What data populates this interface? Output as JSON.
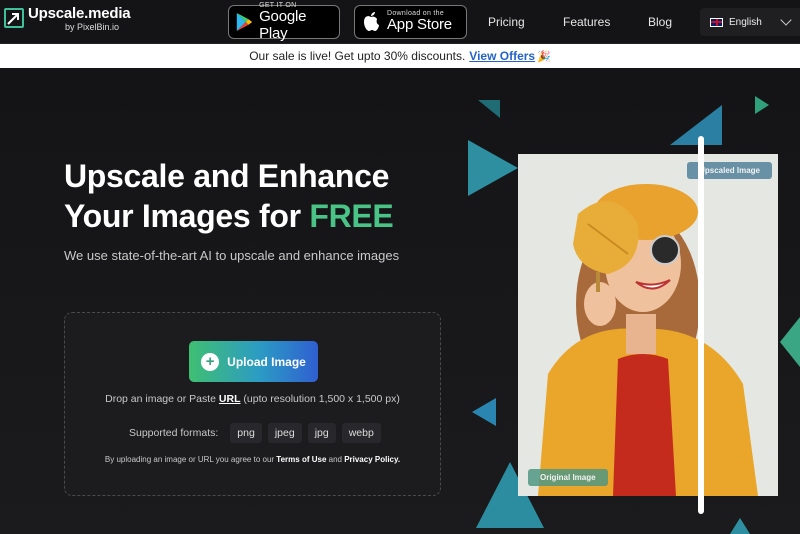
{
  "brand": {
    "name": "Upscale.media",
    "sub": "by PixelBin.io"
  },
  "stores": {
    "google": {
      "small": "GET IT ON",
      "big": "Google Play"
    },
    "apple": {
      "small": "Download on the",
      "big": "App Store"
    }
  },
  "nav": {
    "pricing": "Pricing",
    "features": "Features",
    "blog": "Blog",
    "language": "English"
  },
  "banner": {
    "text": "Our sale is live! Get upto 30% discounts.",
    "link": "View Offers",
    "emoji": "🎉"
  },
  "hero": {
    "line1": "Upscale and Enhance",
    "line2_pre": "Your Images for ",
    "line2_accent": "FREE",
    "subhead": "We use state-of-the-art AI to upscale and enhance images"
  },
  "upload": {
    "button": "Upload Image",
    "drop_pre": "Drop an image or Paste ",
    "drop_link": "URL",
    "drop_post": " (upto resolution 1,500 x 1,500 px)",
    "formats_label": "Supported formats:",
    "formats": [
      "png",
      "jpeg",
      "jpg",
      "webp"
    ],
    "terms_pre": "By uploading an image or URL you agree to our ",
    "terms_link1": "Terms of Use",
    "terms_mid": " and ",
    "terms_link2": "Privacy Policy."
  },
  "preview": {
    "upscaled_tag": "Upscaled Image",
    "original_tag": "Original Image"
  },
  "colors": {
    "accent_green": "#4ac486",
    "link_blue": "#2563c9",
    "page_bg": "#17171a"
  }
}
